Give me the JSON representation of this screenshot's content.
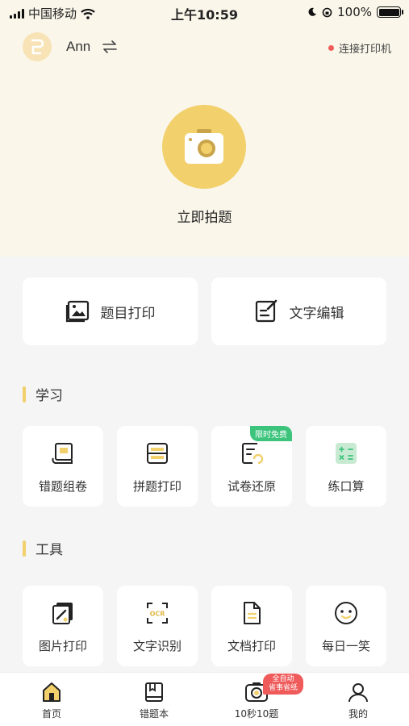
{
  "status_bar": {
    "carrier": "中国移动",
    "time": "上午10:59",
    "battery": "100%"
  },
  "header": {
    "username": "Ann",
    "printer_link": "连接打印机",
    "camera_label": "立即拍题"
  },
  "quick_actions": [
    {
      "label": "题目打印",
      "icon": "image-icon"
    },
    {
      "label": "文字编辑",
      "icon": "edit-icon"
    }
  ],
  "study": {
    "title": "学习",
    "items": [
      {
        "label": "错题组卷",
        "icon": "paper-roll-icon"
      },
      {
        "label": "拼题打印",
        "icon": "combine-print-icon"
      },
      {
        "label": "试卷还原",
        "icon": "exam-restore-icon",
        "tag": "限时免费"
      },
      {
        "label": "练口算",
        "icon": "calculator-icon"
      }
    ]
  },
  "tools": {
    "title": "工具",
    "items": [
      {
        "label": "图片打印",
        "icon": "picture-print-icon"
      },
      {
        "label": "文字识别",
        "icon": "ocr-icon",
        "icon_text": "OCR"
      },
      {
        "label": "文档打印",
        "icon": "document-icon"
      },
      {
        "label": "每日一笑",
        "icon": "smile-icon"
      }
    ]
  },
  "tabbar": {
    "tabs": [
      {
        "label": "首页",
        "icon": "home-icon",
        "active": true
      },
      {
        "label": "错题本",
        "icon": "notebook-icon"
      },
      {
        "label": "10秒10题",
        "icon": "camera-tab-icon"
      },
      {
        "label": "我的",
        "icon": "profile-icon"
      }
    ],
    "badge_line1": "全自动",
    "badge_line2": "省事省纸"
  },
  "colors": {
    "accent": "#f2d06c",
    "header_bg": "#faf6ea",
    "tag_green": "#3cc47c",
    "badge_red": "#ef5b5b"
  }
}
